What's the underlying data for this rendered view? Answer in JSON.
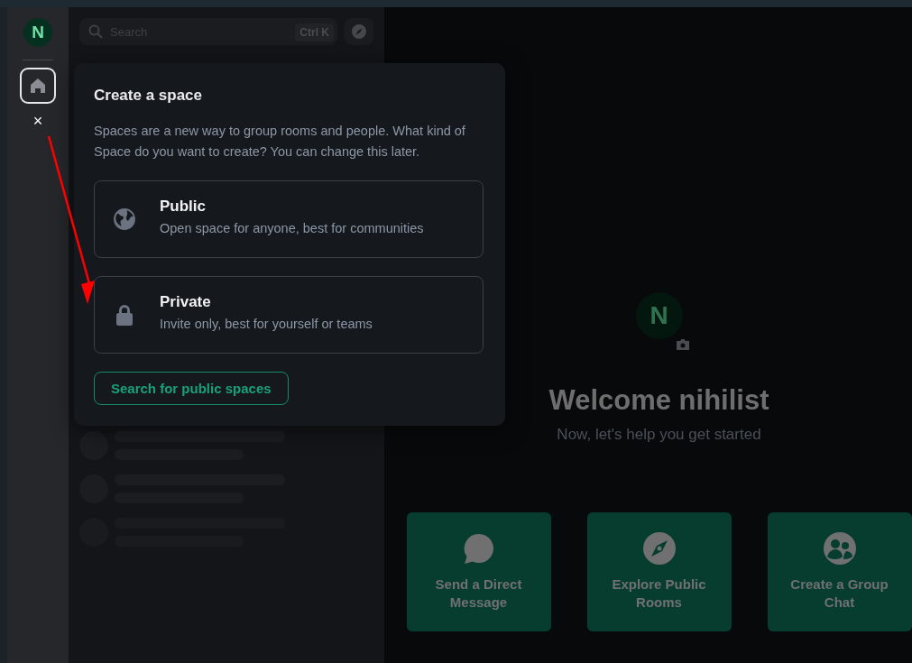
{
  "space_bar": {
    "avatar": "N",
    "home": {
      "selected": true
    },
    "close": "×"
  },
  "search": {
    "placeholder": "Search",
    "shortcut": "Ctrl K"
  },
  "dialog": {
    "title": "Create a space",
    "description": "Spaces are a new way to group rooms and people. What kind of Space do you want to create? You can change this later.",
    "options": [
      {
        "kind": "public",
        "title": "Public",
        "description": "Open space for anyone, best for communities"
      },
      {
        "kind": "private",
        "title": "Private",
        "description": "Invite only, best for yourself or teams"
      }
    ],
    "button": "Search for public spaces"
  },
  "welcome": {
    "avatar": "N",
    "title": "Welcome nihilist",
    "subtitle": "Now, let's help you get started",
    "actions": [
      {
        "kind": "message",
        "label": "Send a Direct Message"
      },
      {
        "kind": "explore",
        "label": "Explore Public Rooms"
      },
      {
        "kind": "group",
        "label": "Create a Group Chat"
      }
    ]
  }
}
